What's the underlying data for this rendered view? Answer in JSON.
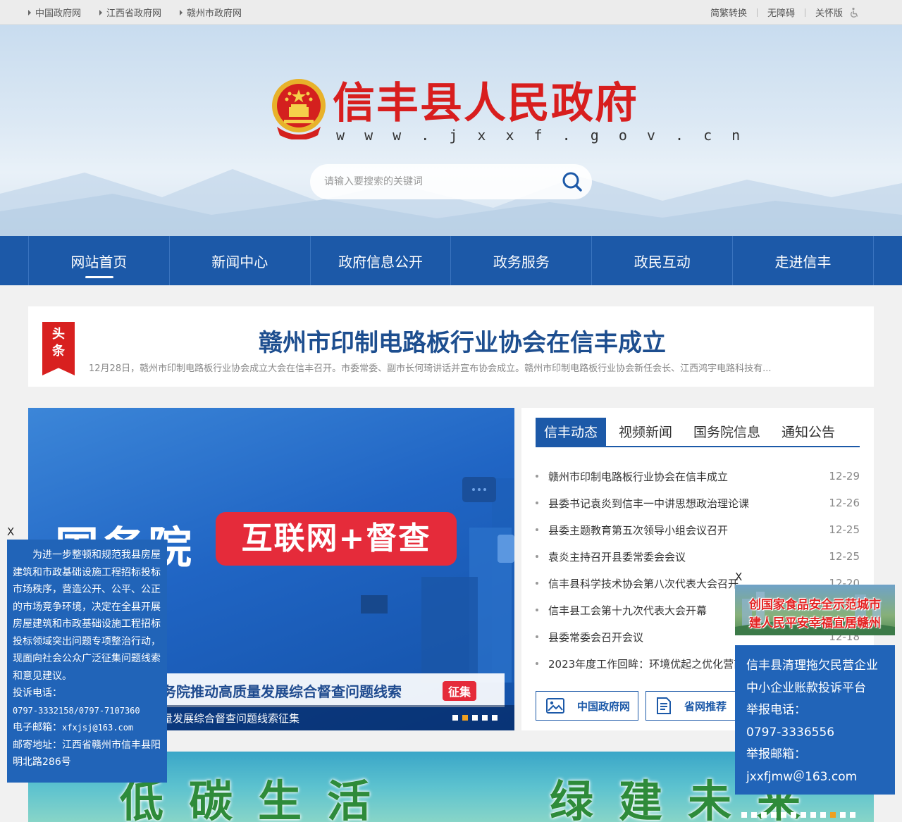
{
  "topbar": {
    "links": [
      "中国政府网",
      "江西省政府网",
      "赣州市政府网"
    ],
    "tools": [
      "简繁转换",
      "无障碍",
      "关怀版"
    ]
  },
  "header": {
    "title": "信丰县人民政府",
    "url": "w w w . j x x f . g o v . c n",
    "search_placeholder": "请输入要搜索的关键词"
  },
  "nav": {
    "items": [
      "网站首页",
      "新闻中心",
      "政府信息公开",
      "政务服务",
      "政民互动",
      "走进信丰"
    ],
    "active_index": 0
  },
  "headline": {
    "tag": "头条",
    "title": "赣州市印制电路板行业协会在信丰成立",
    "summary": "12月28日，赣州市印制电路板行业协会成立大会在信丰召开。市委常委、副市长何琦讲话并宣布协会成立。赣州市印制电路板行业协会新任会长、江西鸿宇电路科技有..."
  },
  "slider": {
    "big_text": "国务院",
    "pill_text": "互联网+督查",
    "banner_text": "务院推动高质量发展综合督查问题线索",
    "banner_badge": "征集",
    "caption": "量发展综合督查问题线索征集",
    "dot_count": 5,
    "active_dot": 1
  },
  "news": {
    "tabs": [
      "信丰动态",
      "视频新闻",
      "国务院信息",
      "通知公告"
    ],
    "active_tab": 0,
    "items": [
      {
        "title": "赣州市印制电路板行业协会在信丰成立",
        "date": "12-29"
      },
      {
        "title": "县委书记袁炎到信丰一中讲思想政治理论课",
        "date": "12-26"
      },
      {
        "title": "县委主题教育第五次领导小组会议召开",
        "date": "12-25"
      },
      {
        "title": "袁炎主持召开县委常委会会议",
        "date": "12-25"
      },
      {
        "title": "信丰县科学技术协会第八次代表大会召开",
        "date": "12-20"
      },
      {
        "title": "信丰县工会第十九次代表大会开幕",
        "date": "12-19"
      },
      {
        "title": "县委常委会召开会议",
        "date": "12-18"
      },
      {
        "title": "2023年度工作回眸：环境优起之优化营商环境",
        "date": ""
      }
    ],
    "quick_links": [
      "中国政府网",
      "省网推荐"
    ]
  },
  "banner2": {
    "left_text": "低碳生活",
    "right_text": "绿建未来",
    "dot_count": 12,
    "active_dot": 9
  },
  "float_left": {
    "close": "X",
    "paragraph": "为进一步整顿和规范我县房屋建筑和市政基础设施工程招标投标市场秩序，营造公开、公平、公正的市场竞争环境，决定在全县开展房屋建筑和市政基础设施工程招标投标领域突出问题专项整治行动，现面向社会公众广泛征集问题线索和意见建议。",
    "phone_label": "投诉电话：",
    "phone": "0797-3332158/0797-7107360",
    "email_label": "电子邮箱：",
    "email": "xfxjsj@163.com",
    "address_label": "邮寄地址：",
    "address": "江西省赣州市信丰县阳明北路286号"
  },
  "float_right": {
    "close": "X",
    "image_line1": "创国家食品安全示范城市",
    "image_line2": "建人民平安幸福宜居赣州",
    "lines": [
      "信丰县清理拖欠民营企业",
      "中小企业账款投诉平台",
      "举报电话：",
      "0797-3336556",
      "举报邮箱：",
      "jxxfjmw＠163.com"
    ]
  },
  "colors": {
    "nav_blue": "#1c59a8",
    "title_red": "#d81e1e",
    "headline_blue": "#1d4e8f",
    "float_blue": "#2164b8"
  }
}
